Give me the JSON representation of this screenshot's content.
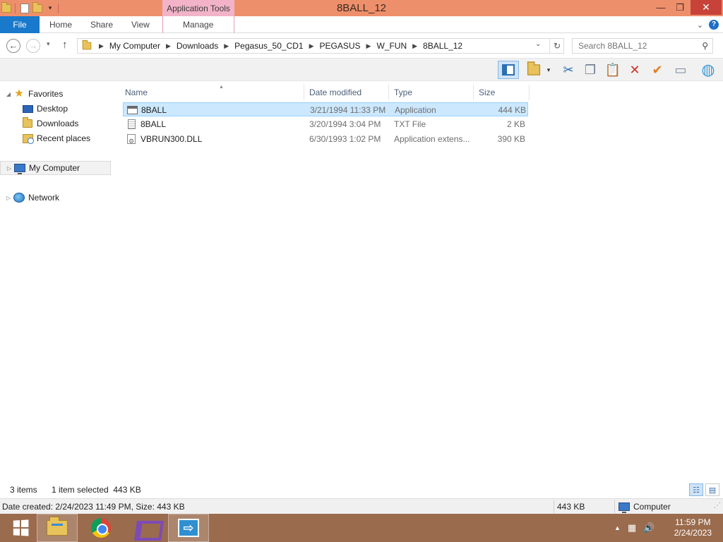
{
  "window": {
    "title": "8BALL_12",
    "context_tab_group": "Application Tools",
    "minimize_glyph": "—",
    "maximize_glyph": "❐",
    "close_glyph": "✕"
  },
  "ribbon": {
    "tabs": [
      "File",
      "Home",
      "Share",
      "View",
      "Manage"
    ],
    "expand_glyph": "⌄",
    "help_glyph": "?"
  },
  "navigation": {
    "back_glyph": "←",
    "forward_glyph": "→",
    "recent_glyph": "▾",
    "up_glyph": "↑",
    "refresh_glyph": "↻",
    "address_dropdown_glyph": "⌄"
  },
  "breadcrumb": [
    "My Computer",
    "Downloads",
    "Pegasus_50_CD1",
    "PEGASUS",
    "W_FUN",
    "8BALL_12"
  ],
  "search": {
    "placeholder": "Search 8BALL_12",
    "glyph": "⚲"
  },
  "toolbar": {
    "icons": [
      "preview-pane-icon",
      "folder-options-icon",
      "cut-icon",
      "copy-icon",
      "paste-icon",
      "delete-icon",
      "check-icon",
      "rename-icon",
      "globe-icon"
    ],
    "dropdown_glyph": "▾",
    "cut_glyph": "✂",
    "copy_glyph": "❐",
    "paste_glyph": "📋",
    "delete_glyph": "✕",
    "check_glyph": "✔",
    "rename_glyph": "▭",
    "globe_glyph": "◍"
  },
  "nav_pane": {
    "favorites": {
      "label": "Favorites",
      "glyph": "★",
      "expander": "◢"
    },
    "favorites_items": [
      "Desktop",
      "Downloads",
      "Recent places"
    ],
    "computer": {
      "label": "My Computer",
      "expander": "▷"
    },
    "network": {
      "label": "Network",
      "expander": "▷"
    }
  },
  "file_list": {
    "columns": [
      "Name",
      "Date modified",
      "Type",
      "Size"
    ],
    "sort_glyph": "▲",
    "rows": [
      {
        "name": "8BALL",
        "date": "3/21/1994 11:33 PM",
        "type": "Application",
        "size": "444 KB",
        "icon": "application-icon",
        "selected": true
      },
      {
        "name": "8BALL",
        "date": "3/20/1994 3:04 PM",
        "type": "TXT File",
        "size": "2 KB",
        "icon": "text-file-icon",
        "selected": false
      },
      {
        "name": "VBRUN300.DLL",
        "date": "6/30/1993 1:02 PM",
        "type": "Application extens...",
        "size": "390 KB",
        "icon": "dll-file-icon",
        "selected": false
      }
    ]
  },
  "status": {
    "item_count": "3 items",
    "selection": "1 item selected  443 KB",
    "details_view_glyph": "☷",
    "tiles_view_glyph": "▤"
  },
  "details_bar": {
    "info": "Date created: 2/24/2023 11:49 PM, Size: 443 KB",
    "size": "443 KB",
    "location": "Computer",
    "grip_glyph": "⋰"
  },
  "taskbar": {
    "apps": [
      "start-icon",
      "file-explorer-icon",
      "chrome-icon",
      "visual-studio-icon",
      "remote-desktop-icon"
    ],
    "remote_glyph": "⇨",
    "tray": {
      "chevron_glyph": "▲",
      "network_glyph": "▦",
      "volume_glyph": "🔊"
    },
    "clock_time": "11:59 PM",
    "clock_date": "2/24/2023"
  },
  "colors": {
    "titlebar": "#ee8f6c",
    "context_tab": "#f2b3c9",
    "file_tab": "#1979ca",
    "selection": "#cce8ff",
    "taskbar": "#9a6b4d"
  }
}
